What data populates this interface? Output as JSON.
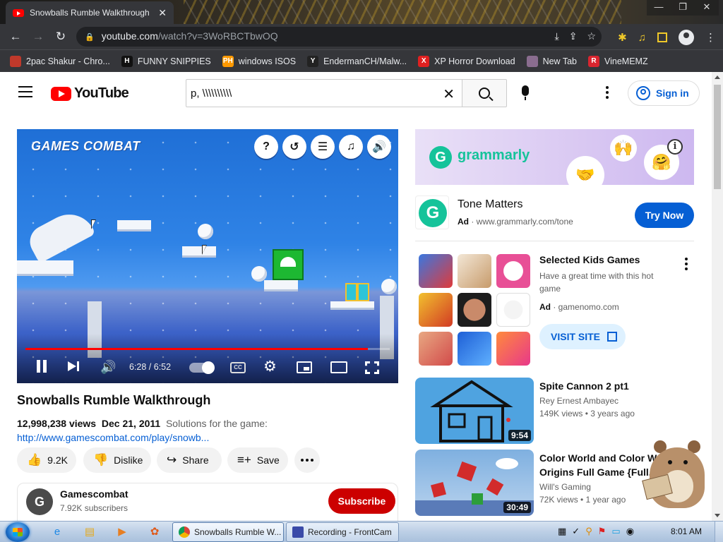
{
  "browser": {
    "tab_title": "Snowballs Rumble Walkthrough",
    "tab_close": "✕",
    "window_controls": [
      "—",
      "❐",
      "✕"
    ],
    "url_host": "youtube.com",
    "url_path": "/watch?v=3WoRBCTbwOQ",
    "bookmarks": [
      {
        "label": "2pac Shakur - Chro...",
        "icon": "",
        "color": "#c0392b"
      },
      {
        "label": "FUNNY SNIPPIES",
        "icon": "H",
        "color": "#111111"
      },
      {
        "label": "windows ISOS",
        "icon": "PH",
        "color": "#ff9900"
      },
      {
        "label": "EndermanCH/Malw...",
        "icon": "Y",
        "color": "#222222"
      },
      {
        "label": "XP Horror Download",
        "icon": "X",
        "color": "#e02020"
      },
      {
        "label": "New Tab",
        "icon": "",
        "color": "#8a6d8f"
      },
      {
        "label": "VineMEMZ",
        "icon": "R",
        "color": "#d9252f"
      }
    ]
  },
  "youtube": {
    "logo_text": "YouTube",
    "search_value": "p, \\\\\\\\\\\\\\\\\\\\",
    "sign_in": "Sign in"
  },
  "player": {
    "game_logo": "GAMES COMBAT",
    "game_buttons": [
      "?",
      "↺",
      "☰",
      "♫",
      "🔊"
    ],
    "time": "6:28 / 6:52",
    "progress": 0.94,
    "cc": "CC"
  },
  "video": {
    "title": "Snowballs Rumble Walkthrough",
    "views": "12,998,238 views",
    "date": "Dec 21, 2011",
    "description": "Solutions for the game:",
    "link": "http://www.gamescombat.com/play/snowb...",
    "likes": "9.2K",
    "dislike": "Dislike",
    "share": "Share",
    "save": "Save"
  },
  "channel": {
    "avatar_letter": "G",
    "name": "Gamescombat",
    "subscribers": "7.92K subscribers",
    "subscribe": "Subscribe"
  },
  "ads": {
    "grammarly_word": "grammarly",
    "tone_title": "Tone Matters",
    "ad_label": "Ad",
    "tone_url": "www.grammarly.com/tone",
    "try_now": "Try Now",
    "games_title": "Selected Kids Games",
    "games_desc": "Have a great time with this hot game",
    "games_domain": "gamenomo.com",
    "visit_site": "VISIT SITE"
  },
  "recommendations": [
    {
      "title": "Spite Cannon 2 pt1",
      "channel": "Rey Ernest Ambayec",
      "meta": "149K views • 3 years ago",
      "duration": "9:54"
    },
    {
      "title": "Color World and Color World Origins Full Game {Full...",
      "channel": "Will's Gaming",
      "meta": "72K views • 1 year ago",
      "duration": "30:49"
    }
  ],
  "taskbar": {
    "tasks": [
      "Snowballs Rumble W...",
      "Recording - FrontCam"
    ],
    "clock": "8:01 AM"
  }
}
